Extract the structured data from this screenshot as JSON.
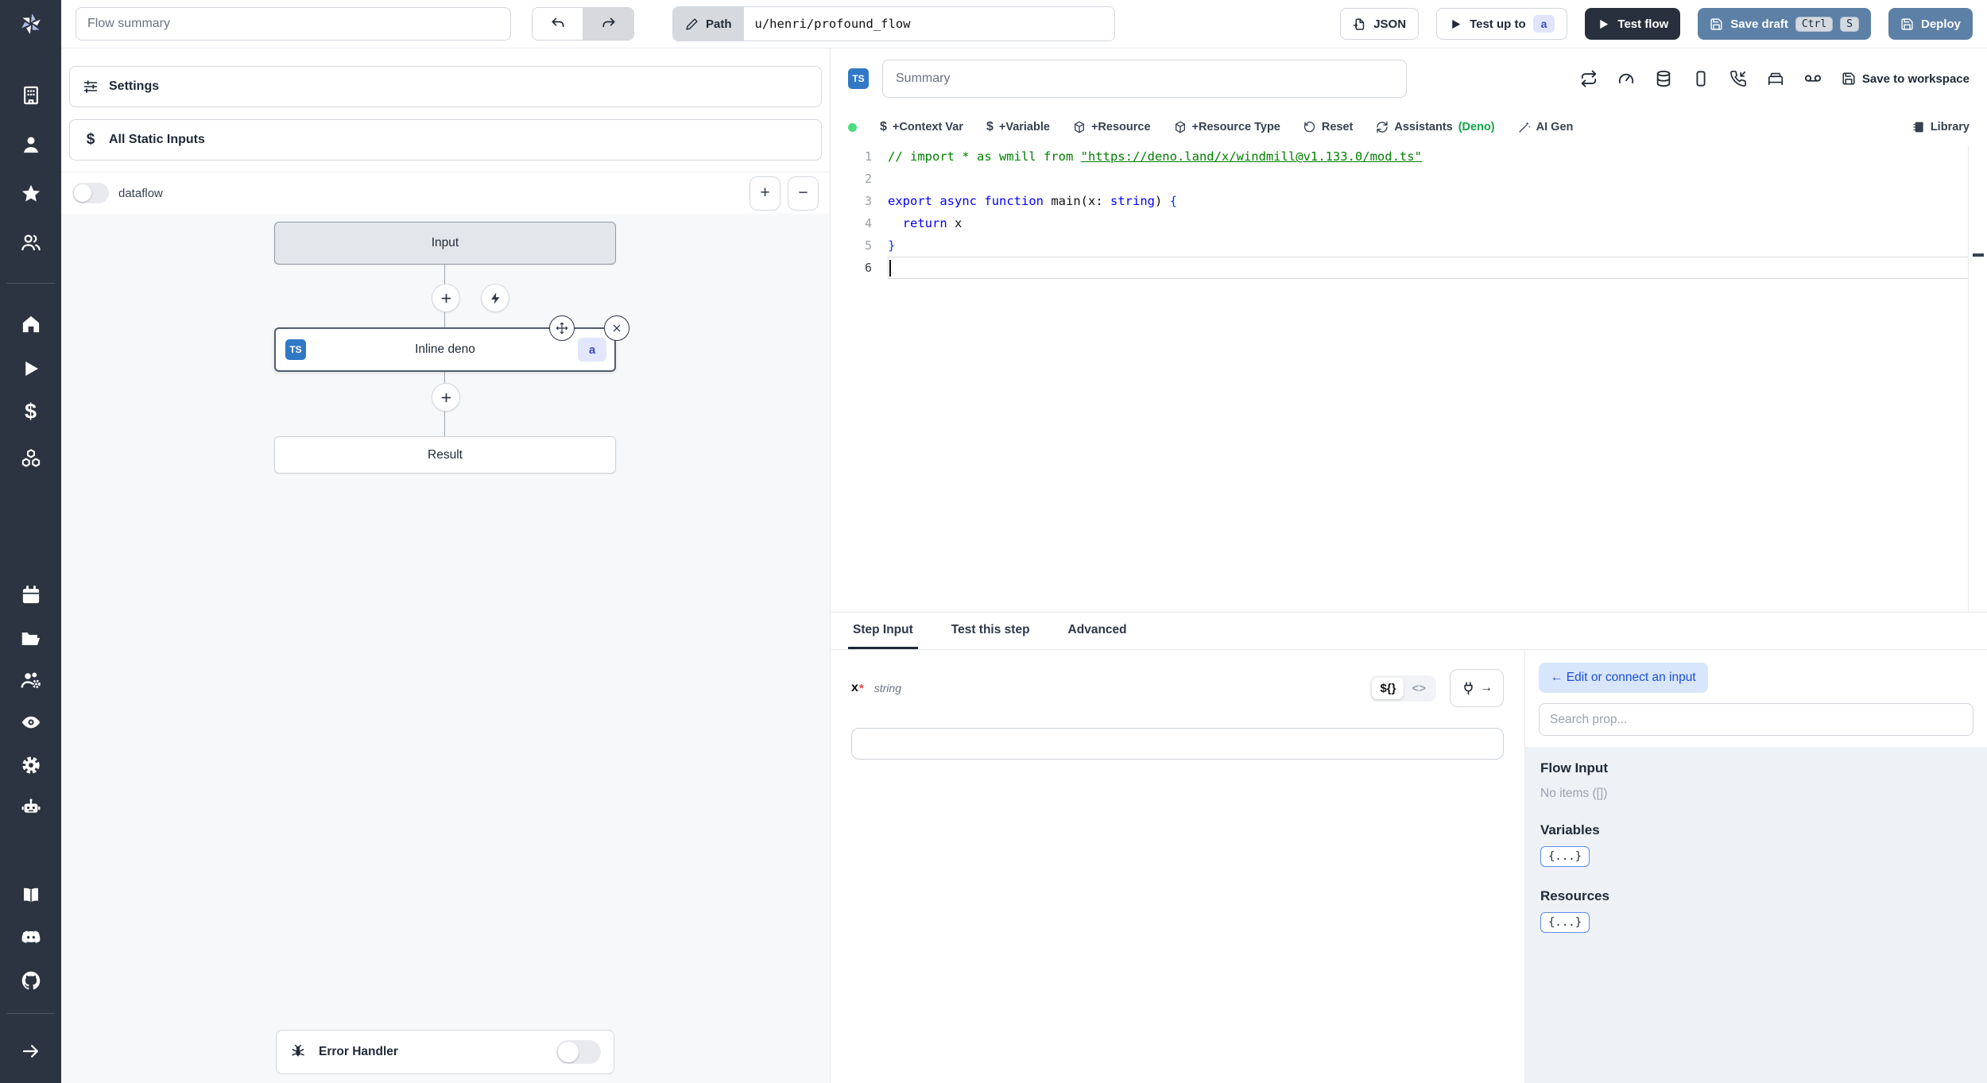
{
  "topbar": {
    "flow_summary_placeholder": "Flow summary",
    "path_label": "Path",
    "path_value": "u/henri/profound_flow",
    "json_label": "JSON",
    "test_up_to_label": "Test up to",
    "test_up_to_step": "a",
    "test_flow_label": "Test flow",
    "save_draft_label": "Save draft",
    "save_draft_kbd": [
      "Ctrl",
      "S"
    ],
    "deploy_label": "Deploy"
  },
  "sidebar": {
    "icons": [
      "windmill-logo",
      "building",
      "user",
      "star",
      "users",
      "home",
      "play",
      "dollar",
      "boxes",
      "calendar",
      "folder-open",
      "user-cog",
      "eye",
      "settings-gear",
      "bot",
      "book-open",
      "discord",
      "github",
      "expand-arrow"
    ]
  },
  "left_panel": {
    "settings_label": "Settings",
    "static_inputs_label": "All Static Inputs",
    "dataflow_label": "dataflow",
    "zoom_in": "+",
    "zoom_out": "−",
    "graph": {
      "input_label": "Input",
      "step": {
        "lang_badge": "TS",
        "label": "Inline deno",
        "id": "a"
      },
      "result_label": "Result",
      "error_handler_label": "Error Handler"
    }
  },
  "editor": {
    "lang_badge": "TS",
    "summary_placeholder": "Summary",
    "save_to_workspace_label": "Save to workspace",
    "header_icon_names": [
      "reload",
      "gauge",
      "database",
      "smartphone",
      "phone-incoming",
      "bed",
      "voicemail"
    ],
    "toolbar": {
      "context_var": "+Context Var",
      "variable": "+Variable",
      "resource": "+Resource",
      "resource_type": "+Resource Type",
      "reset": "Reset",
      "assistants": "Assistants",
      "assistants_lang": "(Deno)",
      "ai_gen": "AI Gen",
      "library": "Library"
    },
    "code": {
      "lines": [
        {
          "segs": [
            {
              "t": "// import * as wmill from ",
              "c": "comment"
            },
            {
              "t": "\"https://deno.land/x/windmill@v1.133.0/mod.ts\"",
              "c": "comment-link"
            }
          ]
        },
        {
          "segs": []
        },
        {
          "segs": [
            {
              "t": "export",
              "c": "kw"
            },
            {
              "t": " ",
              "c": "plain"
            },
            {
              "t": "async",
              "c": "kw"
            },
            {
              "t": " ",
              "c": "plain"
            },
            {
              "t": "function",
              "c": "kw"
            },
            {
              "t": " main(x: ",
              "c": "plain"
            },
            {
              "t": "string",
              "c": "type"
            },
            {
              "t": ") ",
              "c": "plain"
            },
            {
              "t": "{",
              "c": "bracket"
            }
          ]
        },
        {
          "segs": [
            {
              "t": "  ",
              "c": "plain"
            },
            {
              "t": "return",
              "c": "kw"
            },
            {
              "t": " x",
              "c": "plain"
            }
          ]
        },
        {
          "segs": [
            {
              "t": "}",
              "c": "bracket"
            }
          ]
        },
        {
          "segs": [],
          "cursor": true
        }
      ]
    }
  },
  "bottom": {
    "tabs": [
      "Step Input",
      "Test this step",
      "Advanced"
    ],
    "active_tab": "Step Input",
    "field": {
      "name": "x",
      "required_mark": "*",
      "type": "string",
      "value": ""
    },
    "editor_toggle": {
      "template": "${}",
      "code": "<>"
    },
    "props": {
      "edit_connect_label": "← Edit or connect an input",
      "search_placeholder": "Search prop...",
      "flow_input_title": "Flow Input",
      "flow_input_empty": "No items ([])",
      "variables_title": "Variables",
      "variables_chip": "{...}",
      "resources_title": "Resources",
      "resources_chip": "{...}"
    }
  },
  "colors": {
    "rail_bg": "#2b3440",
    "accent_blue": "#5d80a6",
    "dark_navy": "#28303e",
    "ts_blue": "#3178c6",
    "ready_green": "#4ade80",
    "deno_green": "#16a34a",
    "link_blue": "#1d4ed8",
    "badge_indigo_bg": "#e0e5fd",
    "badge_indigo_text": "#4049c0",
    "comment_green": "#008000",
    "keyword_blue": "#0000ff"
  }
}
